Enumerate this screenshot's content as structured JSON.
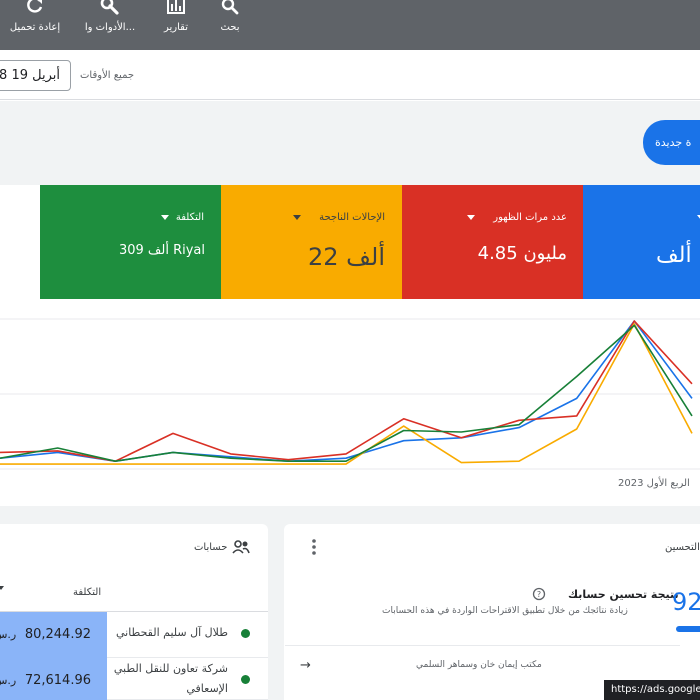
{
  "toolbar": {
    "search_label": "بحث",
    "reports_label": "تقارير",
    "tools_label": "الأدوات وا...",
    "refresh_label": "إعادة تحميل"
  },
  "filter": {
    "date_range_label": "جميع الأوقات",
    "date_value": "8 أبريل 19"
  },
  "new_button_label": "ة جديدة",
  "metrics": [
    {
      "label": "",
      "value": "ألف",
      "color": "#1a73e8"
    },
    {
      "label": "عدد مرات الظهور",
      "value": "4.85 مليون",
      "color": "#d93025"
    },
    {
      "label": "الإحالات الناجحة",
      "value": "22 ألف",
      "color": "#f9ab00"
    },
    {
      "label": "التكلفة",
      "value": "309 ألف Riyal",
      "color": "#1e8e3e"
    }
  ],
  "chart_data": {
    "type": "line",
    "xlabel": "الربع الأول 2023",
    "ylim": [
      0,
      100
    ],
    "x": [
      0,
      1,
      2,
      3,
      4,
      5,
      6,
      7,
      8,
      9,
      10,
      11,
      12
    ],
    "series": [
      {
        "color": "#1a73e8",
        "values": [
          6,
          10,
          4,
          10,
          7,
          4,
          6,
          18,
          20,
          27,
          47,
          100,
          47
        ]
      },
      {
        "color": "#d93025",
        "values": [
          10,
          11,
          4,
          23,
          9,
          5,
          9,
          33,
          20,
          32,
          35,
          100,
          57
        ]
      },
      {
        "color": "#f9ab00",
        "values": [
          2,
          2,
          2,
          2,
          2,
          2,
          2,
          28,
          3,
          4,
          26,
          98,
          23
        ]
      },
      {
        "color": "#188038",
        "values": [
          6,
          13,
          4,
          10,
          6,
          4,
          4,
          25,
          24,
          29,
          62,
          97,
          35
        ]
      }
    ]
  },
  "accounts_card": {
    "title": "حسابات",
    "cost_header": "التكلفة",
    "rows": [
      {
        "name": "طلال آل سليم القحطاني",
        "cost": "80,244.92",
        "currency": "ر.س"
      },
      {
        "name": "شركة تعاون للنقل الطبي",
        "name2": "الإسعافي",
        "cost": "72,614.96",
        "currency": "ر.س"
      }
    ]
  },
  "optimization_card": {
    "title": "التحسين",
    "score_heading": "نتيجة تحسين حسابك",
    "score_desc": "زيادة نتائجك من خلال تطبيق الاقتراحات الواردة في هذه الحسابات",
    "score_value": "92",
    "footer_text": "مكتب إيمان خان وسماهر السلمي"
  },
  "status_url": "https://ads.google"
}
